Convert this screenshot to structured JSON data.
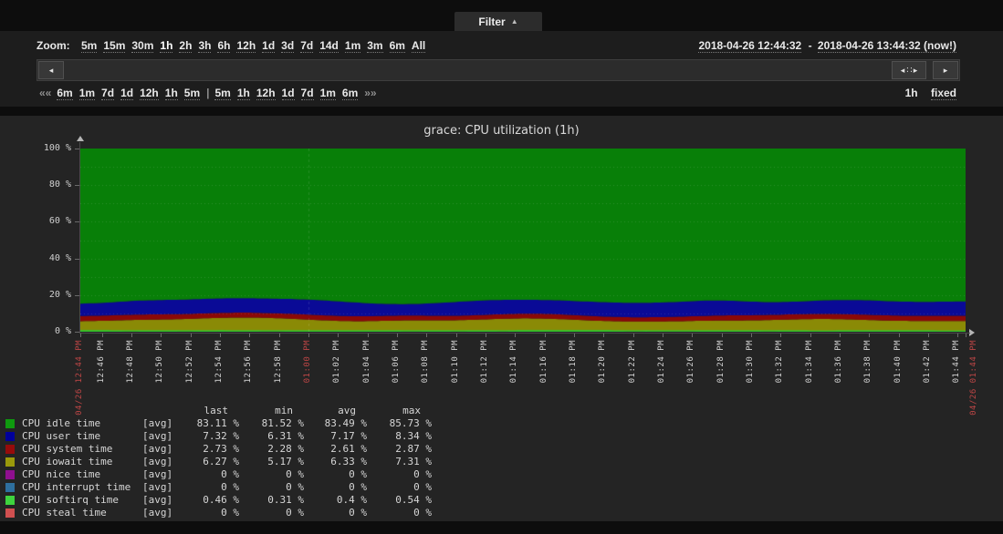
{
  "filter": {
    "tab_label": "Filter",
    "collapse_icon": "▲",
    "zoom_label": "Zoom:",
    "zoom_links": [
      "5m",
      "15m",
      "30m",
      "1h",
      "2h",
      "3h",
      "6h",
      "12h",
      "1d",
      "3d",
      "7d",
      "14d",
      "1m",
      "3m",
      "6m",
      "All"
    ],
    "zoom_selected": "1h",
    "date_from": "2018-04-26 12:44:32",
    "date_separator": "-",
    "date_to": "2018-04-26 13:44:32 (now!)",
    "nav_prev_symbol": "««",
    "nav_next_symbol": "»»",
    "nav_divider": "|",
    "nav_back": [
      "6m",
      "1m",
      "7d",
      "1d",
      "12h",
      "1h",
      "5m"
    ],
    "nav_forward": [
      "5m",
      "1h",
      "12h",
      "1d",
      "7d",
      "1m",
      "6m"
    ],
    "range_label": "1h",
    "fixed_label": "fixed",
    "scroll_left_icon": "◂",
    "scroll_right_icon": "▸",
    "grip_icon": "∷"
  },
  "chart_data": {
    "type": "area",
    "stacked": true,
    "title": "grace: CPU utilization (1h)",
    "ylim": [
      0,
      100
    ],
    "y_ticks": [
      "100 %",
      "80 %",
      "60 %",
      "40 %",
      "20 %",
      "0 %"
    ],
    "grid_h_step_pct": 10,
    "x_start_label": "04/26 12:44 PM",
    "x_end_label": "04/26 01:44 PM",
    "x_ticks": [
      "12:46 PM",
      "12:48 PM",
      "12:50 PM",
      "12:52 PM",
      "12:54 PM",
      "12:56 PM",
      "12:58 PM",
      "01:00 PM",
      "01:02 PM",
      "01:04 PM",
      "01:06 PM",
      "01:08 PM",
      "01:10 PM",
      "01:12 PM",
      "01:14 PM",
      "01:16 PM",
      "01:18 PM",
      "01:20 PM",
      "01:22 PM",
      "01:24 PM",
      "01:26 PM",
      "01:28 PM",
      "01:30 PM",
      "01:32 PM",
      "01:34 PM",
      "01:36 PM",
      "01:38 PM",
      "01:40 PM",
      "01:42 PM",
      "01:44 PM"
    ],
    "x_red_ticks": [
      "01:00 PM"
    ],
    "tick_interval_seconds": 120,
    "first_tick_offset_seconds": 88,
    "range_seconds": 3600,
    "legend_headers": [
      "last",
      "min",
      "avg",
      "max"
    ],
    "source_label": "[avg]",
    "stack_order": [
      "softirq",
      "iowait",
      "system",
      "user",
      "idle"
    ],
    "series": [
      {
        "key": "idle",
        "label": "CPU idle time",
        "color": "#0F9A0F",
        "area": "#087F08",
        "last": "83.11 %",
        "min": "81.52 %",
        "avg": "83.49 %",
        "max": "85.73 %"
      },
      {
        "key": "user",
        "label": "CPU user time",
        "color": "#00009B",
        "area": "#0A0A96",
        "last": "7.32 %",
        "min": "6.31 %",
        "avg": "7.17 %",
        "max": "8.34 %"
      },
      {
        "key": "system",
        "label": "CPU system time",
        "color": "#960B0B",
        "area": "#8B0808",
        "last": "2.73 %",
        "min": "2.28 %",
        "avg": "2.61 %",
        "max": "2.87 %"
      },
      {
        "key": "iowait",
        "label": "CPU iowait time",
        "color": "#9A9A0B",
        "area": "#8A8A06",
        "last": "6.27 %",
        "min": "5.17 %",
        "avg": "6.33 %",
        "max": "7.31 %"
      },
      {
        "key": "nice",
        "label": "CPU nice time",
        "color": "#8F0F8F",
        "last": "0 %",
        "min": "0 %",
        "avg": "0 %",
        "max": "0 %"
      },
      {
        "key": "interrupt",
        "label": "CPU interrupt time",
        "color": "#2E6F9E",
        "last": "0 %",
        "min": "0 %",
        "avg": "0 %",
        "max": "0 %"
      },
      {
        "key": "softirq",
        "label": "CPU softirq time",
        "color": "#3ED33E",
        "area": "#2FC42F",
        "last": "0.46 %",
        "min": "0.31 %",
        "avg": "0.4 %",
        "max": "0.54 %"
      },
      {
        "key": "steal",
        "label": "CPU steal time",
        "color": "#D05050",
        "last": "0 %",
        "min": "0 %",
        "avg": "0 %",
        "max": "0 %"
      }
    ]
  }
}
